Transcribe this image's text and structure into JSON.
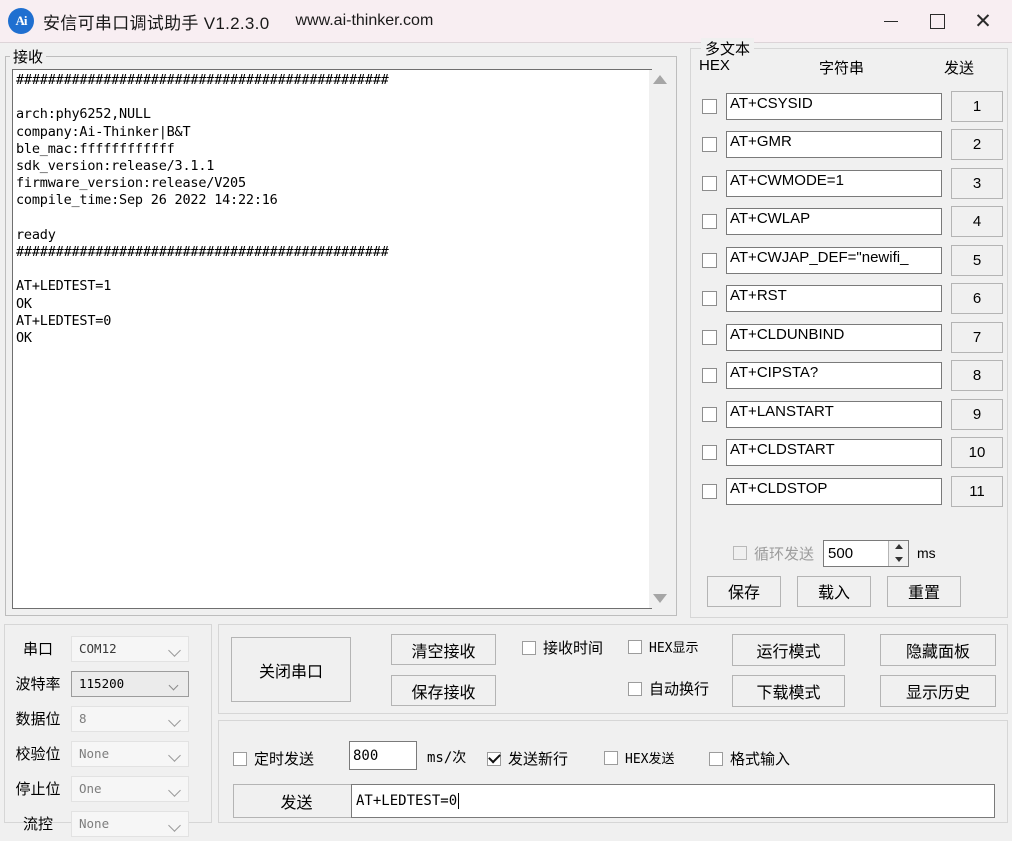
{
  "titlebar": {
    "logo_text": "Ai",
    "title": "安信可串口调试助手 V1.2.3.0",
    "url": "www.ai-thinker.com",
    "minimize": "—",
    "maximize": "□",
    "close": "✕"
  },
  "receive": {
    "label": "接收",
    "content": "###############################################\n\narch:phy6252,NULL\ncompany:Ai-Thinker|B&T\nble_mac:ffffffffffff\nsdk_version:release/3.1.1\nfirmware_version:release/V205\ncompile_time:Sep 26 2022 14:22:16\n\nready\n###############################################\n\nAT+LEDTEST=1\nOK\nAT+LEDTEST=0\nOK\n"
  },
  "multitext": {
    "label": "多文本",
    "header_hex": "HEX",
    "header_string": "字符串",
    "header_send": "发送",
    "rows": [
      {
        "value": "AT+CSYSID",
        "button": "1"
      },
      {
        "value": "AT+GMR",
        "button": "2"
      },
      {
        "value": "AT+CWMODE=1",
        "button": "3"
      },
      {
        "value": "AT+CWLAP",
        "button": "4"
      },
      {
        "value": "AT+CWJAP_DEF=\"newifi_",
        "button": "5"
      },
      {
        "value": "AT+RST",
        "button": "6"
      },
      {
        "value": "AT+CLDUNBIND",
        "button": "7"
      },
      {
        "value": "AT+CIPSTA?",
        "button": "8"
      },
      {
        "value": "AT+LANSTART",
        "button": "9"
      },
      {
        "value": "AT+CLDSTART",
        "button": "10"
      },
      {
        "value": "AT+CLDSTOP",
        "button": "11"
      }
    ],
    "loop_send_label": "循环发送",
    "loop_send_value": "500",
    "loop_send_unit": "ms",
    "save": "保存",
    "load": "载入",
    "reset": "重置"
  },
  "serial": {
    "rows": [
      {
        "label": "串口",
        "value": "COM12"
      },
      {
        "label": "波特率",
        "value": "115200"
      },
      {
        "label": "数据位",
        "value": "8"
      },
      {
        "label": "校验位",
        "value": "None"
      },
      {
        "label": "停止位",
        "value": "One"
      },
      {
        "label": "流控",
        "value": "None"
      }
    ]
  },
  "controls": {
    "close_serial": "关闭串口",
    "clear_recv": "清空接收",
    "save_recv": "保存接收",
    "recv_time": "接收时间",
    "hex_show": "HEX显示",
    "auto_wrap": "自动换行",
    "run_mode": "运行模式",
    "download_mode": "下载模式",
    "hide_panel": "隐藏面板",
    "show_history": "显示历史"
  },
  "sendpanel": {
    "timed_send": "定时发送",
    "timed_value": "800",
    "ms_per": "ms/次",
    "send_newline": "发送新行",
    "hex_send": "HEX发送",
    "format_input": "格式输入",
    "send_button": "发送",
    "input_value": "AT+LEDTEST=0"
  },
  "colors": {
    "titlebar_bg": "#f8eef2",
    "accent": "#1f6fd0",
    "panel_bg": "#f0f0f0"
  }
}
